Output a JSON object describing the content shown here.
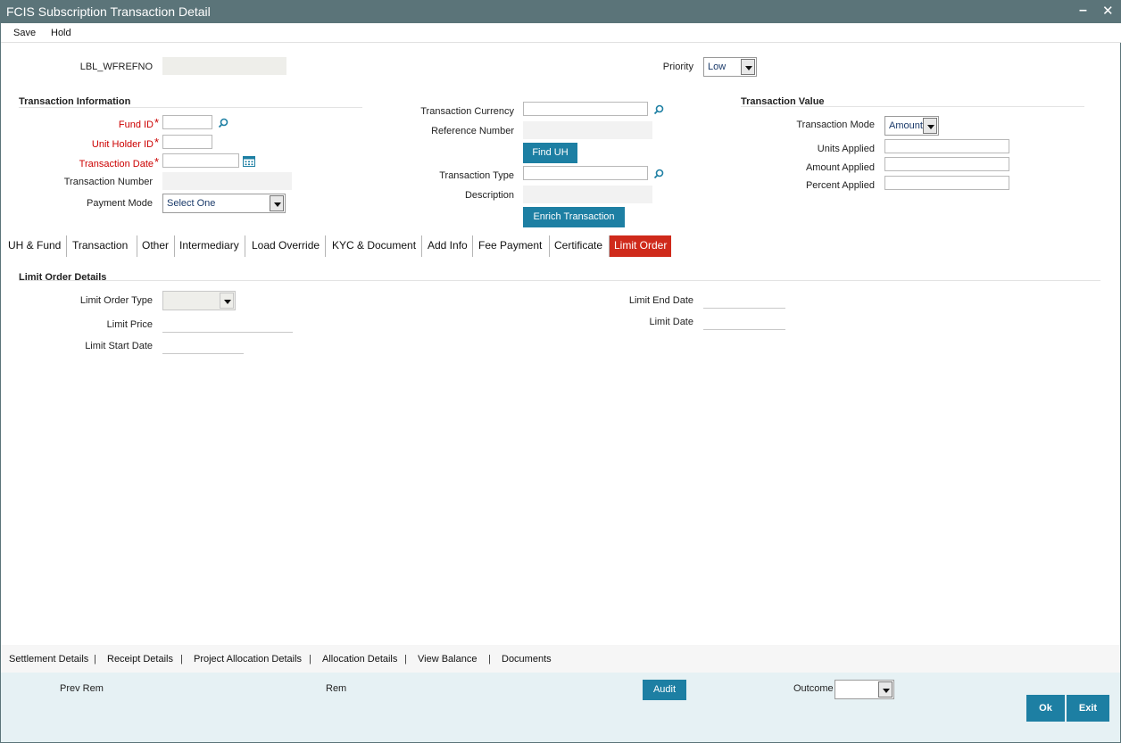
{
  "window": {
    "title": "FCIS Subscription Transaction Detail",
    "minimize": "–",
    "close": "✕"
  },
  "menu": {
    "save": "Save",
    "hold": "Hold"
  },
  "header": {
    "wfrefno_label": "LBL_WFREFNO",
    "priority_label": "Priority",
    "priority_value": "Low"
  },
  "txn_info": {
    "title": "Transaction Information",
    "fund_id": "Fund ID",
    "unit_holder_id": "Unit Holder ID",
    "transaction_date": "Transaction Date",
    "transaction_number": "Transaction Number",
    "payment_mode": "Payment Mode",
    "payment_mode_value": "Select One",
    "required_mark": "*"
  },
  "middle": {
    "transaction_currency": "Transaction Currency",
    "reference_number": "Reference Number",
    "find_uh": "Find UH",
    "transaction_type": "Transaction Type",
    "description": "Description",
    "enrich_transaction": "Enrich Transaction"
  },
  "txn_value": {
    "title": "Transaction Value",
    "transaction_mode": "Transaction Mode",
    "transaction_mode_value": "Amount",
    "units_applied": "Units Applied",
    "amount_applied": "Amount Applied",
    "percent_applied": "Percent Applied"
  },
  "tabs": [
    "UH & Fund",
    "Transaction",
    "Other",
    "Intermediary",
    "Load Override",
    "KYC & Document",
    "Add Info",
    "Fee Payment",
    "Certificate",
    "Limit Order"
  ],
  "limit_order": {
    "title": "Limit Order Details",
    "limit_order_type": "Limit Order Type",
    "limit_price": "Limit Price",
    "limit_start_date": "Limit Start Date",
    "limit_end_date": "Limit End Date",
    "limit_date": "Limit Date"
  },
  "footer_links": [
    "Settlement Details",
    "Receipt Details",
    "Project Allocation Details",
    "Allocation Details",
    "View Balance",
    "Documents"
  ],
  "footer_sep": "|",
  "bottom": {
    "prev_rem": "Prev Rem",
    "rem": "Rem",
    "audit": "Audit",
    "outcome": "Outcome",
    "ok": "Ok",
    "exit": "Exit"
  },
  "colors": {
    "titlebar": "#5b7479",
    "button": "#1d7fa3",
    "active_tab": "#cf2a1b",
    "required": "#cc0000"
  }
}
